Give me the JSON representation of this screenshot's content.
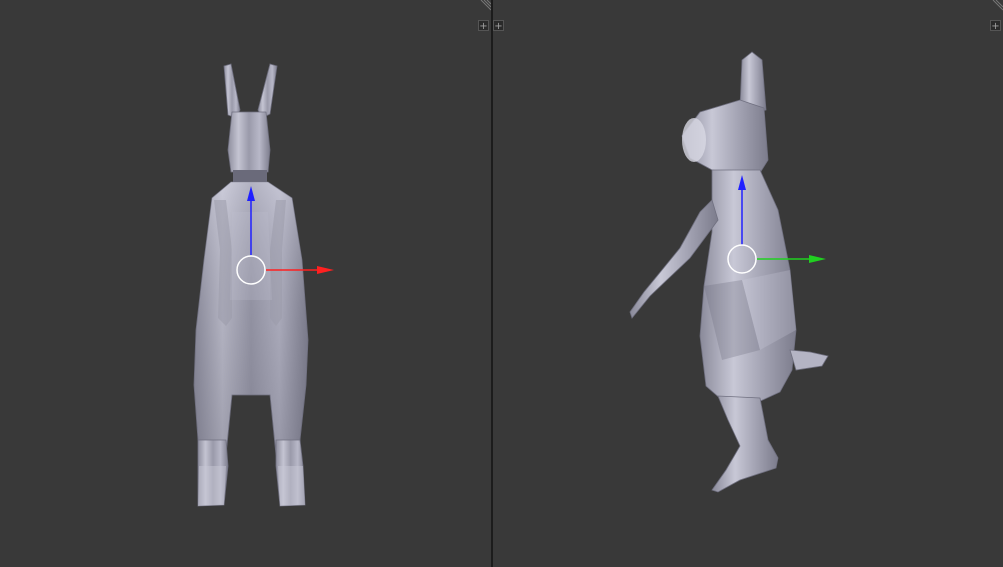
{
  "viewports": [
    {
      "id": "front",
      "view": "front",
      "object": "rabbit-mesh",
      "gizmo_axes": [
        "z",
        "x"
      ]
    },
    {
      "id": "side",
      "view": "side",
      "object": "rabbit-mesh",
      "gizmo_axes": [
        "z",
        "y"
      ]
    }
  ],
  "icons": {
    "corner_widget": "plus-icon",
    "resize_grip": "diagonal-grip-icon"
  },
  "labels": {
    "corner_plus": "+"
  },
  "colors": {
    "background": "#393939",
    "splitter": "#1c1c1c",
    "axis_x": "#ff2020",
    "axis_y": "#20d020",
    "axis_z": "#2020ff",
    "mesh": "#a9a9bb"
  }
}
